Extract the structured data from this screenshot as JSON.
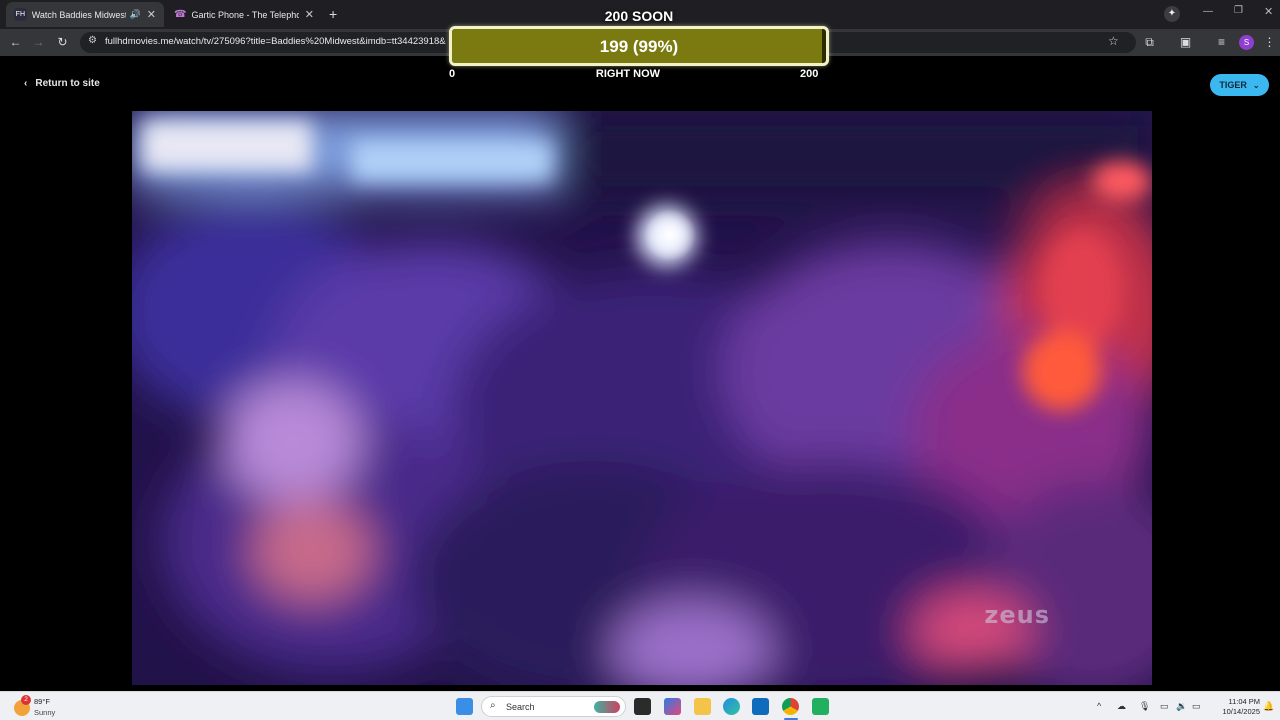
{
  "browser": {
    "tabs": [
      {
        "title": "Watch Baddies Midwest - S",
        "favicon": "FH",
        "active": true,
        "audio": true
      },
      {
        "title": "Gartic Phone - The Telephone G",
        "favicon": "phone",
        "active": false
      }
    ],
    "url": "fullhdmovies.me/watch/tv/275096?title=Baddies%20Midwest&imdb=tt34423918&"
  },
  "page": {
    "return_label": "Return to site",
    "server_button": "TIGER",
    "watermark": "zeus"
  },
  "goal_overlay": {
    "title": "200 SOON",
    "count_text": "199 (99%)",
    "progress": 0.99,
    "min_label": "0",
    "mid_label": "RIGHT NOW",
    "max_label": "200"
  },
  "taskbar": {
    "weather_temp": "89°F",
    "weather_cond": "Sunny",
    "weather_badge": "2",
    "search_placeholder": "Search",
    "time": "11:04 PM",
    "date": "10/14/2025"
  },
  "colors": {
    "accent": "#3cb8f0",
    "goal_fill": "#7a7a10",
    "tab_bg": "#1f1f23",
    "toolbar_bg": "#35363a"
  }
}
